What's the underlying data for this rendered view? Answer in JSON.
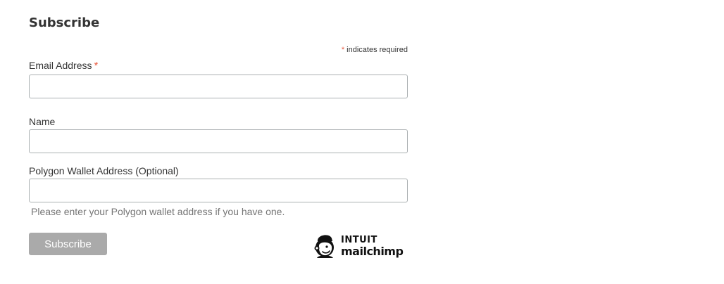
{
  "form": {
    "title": "Subscribe",
    "required_note": {
      "asterisk": "*",
      "text": "indicates required"
    },
    "fields": [
      {
        "label": "Email Address",
        "required_marker": "*",
        "value": "",
        "placeholder": ""
      },
      {
        "label": "Name",
        "value": "",
        "placeholder": ""
      },
      {
        "label": "Polygon Wallet Address (Optional)",
        "value": "",
        "placeholder": ""
      }
    ],
    "wallet_helper": "Please enter your Polygon wallet address if you have one.",
    "subscribe_button": "Subscribe"
  },
  "badge": {
    "line1": "INTUIT",
    "line2": "mailchimp",
    "icon": "mailchimp-freddie-icon"
  },
  "colors": {
    "required": "#e85c41",
    "button_bg": "#aaaaaa",
    "input_border": "#abb0b2",
    "helper_text": "#757575"
  }
}
